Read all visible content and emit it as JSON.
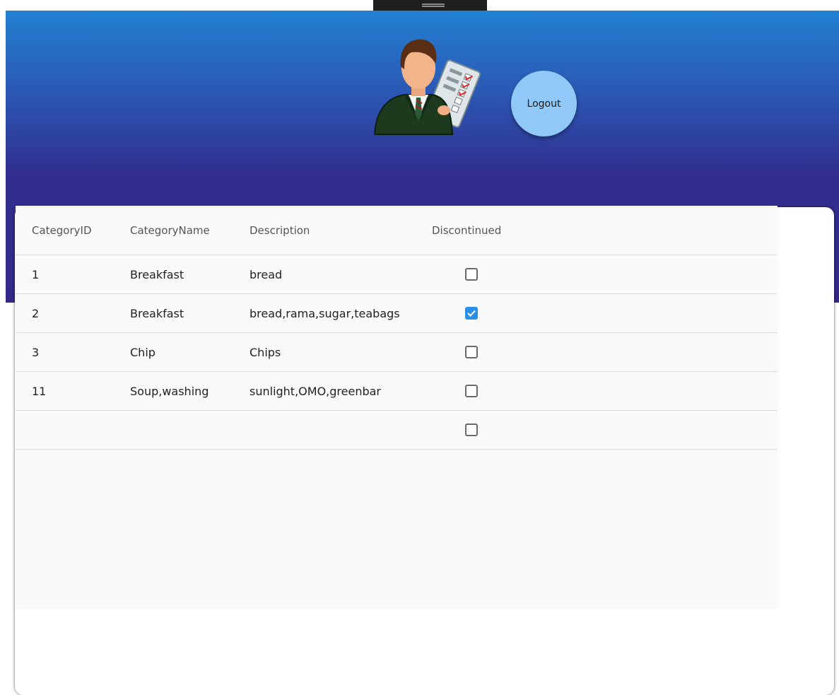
{
  "header": {
    "logout_label": "Logout"
  },
  "grid": {
    "columns": [
      "CategoryID",
      "CategoryName",
      "Description",
      "Discontinued"
    ],
    "rows": [
      {
        "id": "1",
        "name": "Breakfast",
        "description": "bread",
        "discontinued": false
      },
      {
        "id": "2",
        "name": "Breakfast",
        "description": "bread,rama,sugar,teabags",
        "discontinued": true
      },
      {
        "id": "3",
        "name": "Chip",
        "description": "Chips",
        "discontinued": false
      },
      {
        "id": "11",
        "name": "Soup,washing",
        "description": "sunlight,OMO,greenbar",
        "discontinued": false
      },
      {
        "id": "",
        "name": "",
        "description": "",
        "discontinued": false
      }
    ]
  },
  "colors": {
    "header_top": "#2280d2",
    "header_bottom": "#332a88",
    "logout_button": "#90c8f8",
    "checkbox_checked": "#2b8ee8"
  },
  "icons": {
    "avatar": "manager-with-checklist-icon",
    "check": "checkmark-icon"
  }
}
